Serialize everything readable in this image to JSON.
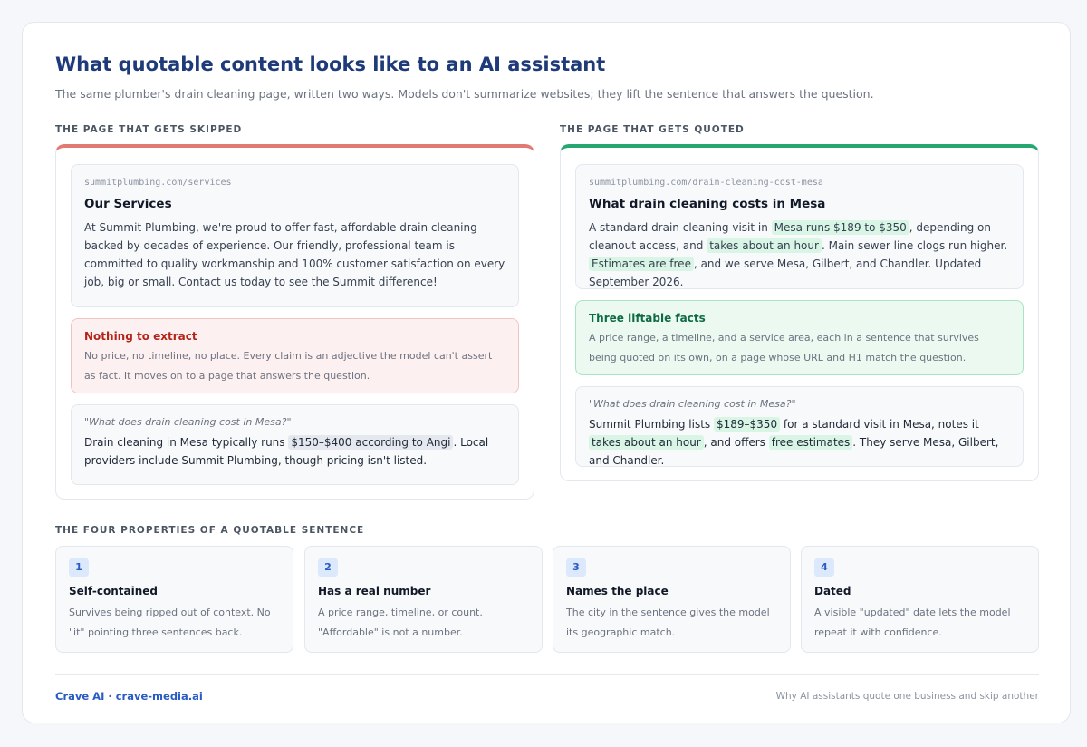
{
  "header": {
    "title": "What quotable content looks like to an AI assistant",
    "subtitle": "The same plumber's drain cleaning page, written two ways. Models don't summarize websites; they lift the sentence that answers the question."
  },
  "skipped": {
    "label": "THE PAGE THAT GETS SKIPPED",
    "accent_color": "#e07a72",
    "page": {
      "url": "summitplumbing.com/services",
      "h1": "Our Services",
      "body": "At Summit Plumbing, we're proud to offer fast, affordable drain cleaning backed by decades of experience. Our friendly, professional team is committed to quality workmanship and 100% customer satisfaction on every job, big or small. Contact us today to see the Summit difference!"
    },
    "verdict": {
      "heading": "Nothing to extract",
      "text": "No price, no timeline, no place. Every claim is an adjective the model can't assert as fact. It moves on to a page that answers the question."
    },
    "ai_answer": {
      "query": "\"What does drain cleaning cost in Mesa?\"",
      "parts": {
        "t1": "Drain cleaning in Mesa typically runs ",
        "h1": "$150–$400 according to Angi",
        "t2": ". Local providers include Summit Plumbing, though pricing isn't listed."
      }
    }
  },
  "quoted": {
    "label": "THE PAGE THAT GETS QUOTED",
    "accent_color": "#26a772",
    "page": {
      "url": "summitplumbing.com/drain-cleaning-cost-mesa",
      "h1": "What drain cleaning costs in Mesa",
      "parts": {
        "t1": "A standard drain cleaning visit in ",
        "h1": "Mesa runs $189 to $350",
        "t2": ", depending on cleanout access, and ",
        "h2": "takes about an hour",
        "t3": ". Main sewer line clogs run higher. ",
        "h3": "Estimates are free",
        "t4": ", and we serve Mesa, Gilbert, and Chandler. Updated September 2026."
      }
    },
    "verdict": {
      "heading": "Three liftable facts",
      "text": "A price range, a timeline, and a service area, each in a sentence that survives being quoted on its own, on a page whose URL and H1 match the question."
    },
    "ai_answer": {
      "query": "\"What does drain cleaning cost in Mesa?\"",
      "parts": {
        "t1": "Summit Plumbing lists ",
        "h1": "$189–$350",
        "t2": " for a standard visit in Mesa, notes it ",
        "h2": "takes about an hour",
        "t3": ", and offers ",
        "h3": "free estimates",
        "t4": ". They serve Mesa, Gilbert, and Chandler."
      }
    }
  },
  "properties": {
    "label": "THE FOUR PROPERTIES OF A QUOTABLE SENTENCE",
    "items": [
      {
        "num": "1",
        "title": "Self-contained",
        "text": "Survives being ripped out of context. No \"it\" pointing three sentences back."
      },
      {
        "num": "2",
        "title": "Has a real number",
        "text": "A price range, timeline, or count. \"Affordable\" is not a number."
      },
      {
        "num": "3",
        "title": "Names the place",
        "text": "The city in the sentence gives the model its geographic match."
      },
      {
        "num": "4",
        "title": "Dated",
        "text": "A visible \"updated\" date lets the model repeat it with confidence."
      }
    ]
  },
  "footer": {
    "brand": "Crave AI · crave-media.ai",
    "tagline": "Why AI assistants quote one business and skip another"
  }
}
